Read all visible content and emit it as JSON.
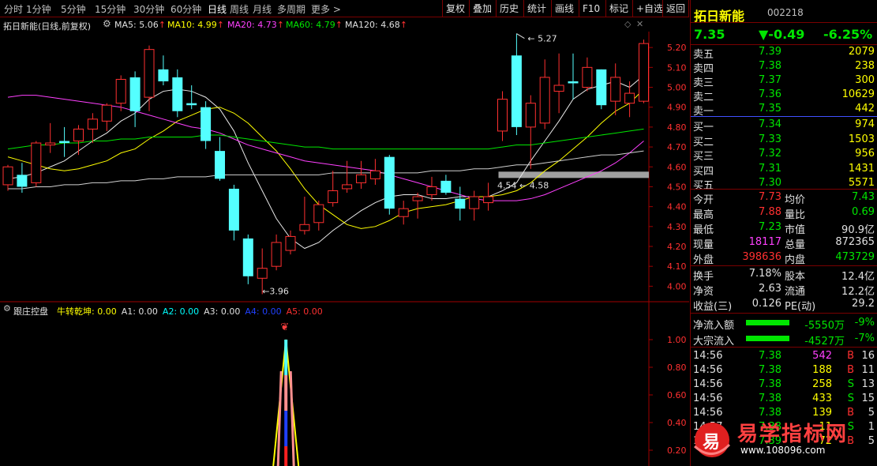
{
  "toolbar": {
    "periods": [
      "分时",
      "1分钟",
      "5分钟",
      "15分钟",
      "30分钟",
      "60分钟",
      "日线",
      "周线",
      "月线",
      "多周期",
      "更多 >"
    ],
    "active_index": 6,
    "right_buttons": [
      "复权",
      "叠加",
      "历史",
      "统计",
      "画线",
      "F10",
      "标记",
      "+自选",
      "返回"
    ]
  },
  "chart_header": {
    "title": "拓日新能(日线,前复权)",
    "ma5": "MA5: 5.06",
    "ma10": "MA10: 4.99",
    "ma20": "MA20: 4.73",
    "ma60": "MA60: 4.79",
    "ma120": "MA120: 4.68",
    "arrow": "↑"
  },
  "chart_data": {
    "type": "candlestick",
    "y_axis_ticks": [
      "5.20",
      "5.10",
      "5.00",
      "4.90",
      "4.80",
      "4.70",
      "4.60",
      "4.50",
      "4.40",
      "4.30",
      "4.20",
      "4.10",
      "4.00"
    ],
    "ylim": [
      3.93,
      5.28
    ],
    "annotations": {
      "high": "5.27",
      "low": "3.96",
      "mid_left": "4.54",
      "mid_right": "4.58"
    },
    "candles": [
      {
        "o": 4.51,
        "h": 4.61,
        "l": 4.48,
        "c": 4.6
      },
      {
        "o": 4.56,
        "h": 4.62,
        "l": 4.47,
        "c": 4.5
      },
      {
        "o": 4.52,
        "h": 4.73,
        "l": 4.5,
        "c": 4.72
      },
      {
        "o": 4.71,
        "h": 4.82,
        "l": 4.67,
        "c": 4.72
      },
      {
        "o": 4.73,
        "h": 4.8,
        "l": 4.65,
        "c": 4.72
      },
      {
        "o": 4.73,
        "h": 4.81,
        "l": 4.66,
        "c": 4.79
      },
      {
        "o": 4.79,
        "h": 4.87,
        "l": 4.72,
        "c": 4.84
      },
      {
        "o": 4.83,
        "h": 4.92,
        "l": 4.78,
        "c": 4.91
      },
      {
        "o": 4.92,
        "h": 5.06,
        "l": 4.88,
        "c": 5.04
      },
      {
        "o": 5.05,
        "h": 5.08,
        "l": 4.8,
        "c": 4.88
      },
      {
        "o": 4.95,
        "h": 5.21,
        "l": 4.88,
        "c": 5.19
      },
      {
        "o": 5.09,
        "h": 5.16,
        "l": 5.01,
        "c": 5.03
      },
      {
        "o": 5.05,
        "h": 5.09,
        "l": 4.85,
        "c": 4.88
      },
      {
        "o": 4.92,
        "h": 5.01,
        "l": 4.89,
        "c": 4.91
      },
      {
        "o": 4.9,
        "h": 4.93,
        "l": 4.69,
        "c": 4.73
      },
      {
        "o": 4.68,
        "h": 4.75,
        "l": 4.53,
        "c": 4.54
      },
      {
        "o": 4.49,
        "h": 4.51,
        "l": 4.23,
        "c": 4.28
      },
      {
        "o": 4.24,
        "h": 4.26,
        "l": 4.01,
        "c": 4.05
      },
      {
        "o": 4.04,
        "h": 4.19,
        "l": 3.96,
        "c": 4.09
      },
      {
        "o": 4.1,
        "h": 4.26,
        "l": 4.08,
        "c": 4.22
      },
      {
        "o": 4.18,
        "h": 4.28,
        "l": 4.16,
        "c": 4.25
      },
      {
        "o": 4.28,
        "h": 4.45,
        "l": 4.26,
        "c": 4.31
      },
      {
        "o": 4.32,
        "h": 4.43,
        "l": 4.28,
        "c": 4.41
      },
      {
        "o": 4.42,
        "h": 4.58,
        "l": 4.4,
        "c": 4.48
      },
      {
        "o": 4.49,
        "h": 4.63,
        "l": 4.47,
        "c": 4.51
      },
      {
        "o": 4.52,
        "h": 4.63,
        "l": 4.49,
        "c": 4.56
      },
      {
        "o": 4.54,
        "h": 4.64,
        "l": 4.51,
        "c": 4.58
      },
      {
        "o": 4.65,
        "h": 4.66,
        "l": 4.36,
        "c": 4.39
      },
      {
        "o": 4.35,
        "h": 4.43,
        "l": 4.31,
        "c": 4.39
      },
      {
        "o": 4.43,
        "h": 4.47,
        "l": 4.34,
        "c": 4.45
      },
      {
        "o": 4.46,
        "h": 4.55,
        "l": 4.43,
        "c": 4.5
      },
      {
        "o": 4.53,
        "h": 4.56,
        "l": 4.46,
        "c": 4.47
      },
      {
        "o": 4.44,
        "h": 4.5,
        "l": 4.33,
        "c": 4.39
      },
      {
        "o": 4.39,
        "h": 4.48,
        "l": 4.33,
        "c": 4.45
      },
      {
        "o": 4.42,
        "h": 4.52,
        "l": 4.38,
        "c": 4.45
      },
      {
        "o": 4.78,
        "h": 4.98,
        "l": 4.73,
        "c": 4.94
      },
      {
        "o": 5.16,
        "h": 5.27,
        "l": 4.76,
        "c": 4.8
      },
      {
        "o": 4.8,
        "h": 4.96,
        "l": 4.59,
        "c": 4.92
      },
      {
        "o": 4.82,
        "h": 5.14,
        "l": 4.79,
        "c": 5.05
      },
      {
        "o": 4.98,
        "h": 5.17,
        "l": 4.87,
        "c": 5.01
      },
      {
        "o": 5.03,
        "h": 5.17,
        "l": 4.94,
        "c": 5.02
      },
      {
        "o": 5.0,
        "h": 5.15,
        "l": 4.98,
        "c": 5.1
      },
      {
        "o": 5.09,
        "h": 5.09,
        "l": 4.89,
        "c": 4.91
      },
      {
        "o": 4.93,
        "h": 5.12,
        "l": 4.86,
        "c": 5.05
      },
      {
        "o": 4.92,
        "h": 5.03,
        "l": 4.85,
        "c": 4.97
      },
      {
        "o": 4.93,
        "h": 5.24,
        "l": 4.92,
        "c": 5.22
      }
    ],
    "ma_lines": [
      {
        "name": "MA5",
        "color": "#e8e8e8",
        "values": [
          4.54,
          4.55,
          4.57,
          4.6,
          4.63,
          4.68,
          4.73,
          4.77,
          4.83,
          4.87,
          4.94,
          4.98,
          4.99,
          4.98,
          4.95,
          4.89,
          4.78,
          4.62,
          4.48,
          4.34,
          4.24,
          4.19,
          4.22,
          4.28,
          4.33,
          4.38,
          4.42,
          4.45,
          4.46,
          4.46,
          4.44,
          4.44,
          4.45,
          4.45,
          4.45,
          4.48,
          4.52,
          4.63,
          4.73,
          4.83,
          4.94,
          4.99,
          5.01,
          5.03,
          5.0,
          5.06
        ]
      },
      {
        "name": "MA10",
        "color": "#ffff00",
        "values": [
          4.65,
          4.63,
          4.61,
          4.59,
          4.58,
          4.59,
          4.61,
          4.63,
          4.67,
          4.69,
          4.74,
          4.78,
          4.83,
          4.86,
          4.89,
          4.9,
          4.87,
          4.82,
          4.75,
          4.68,
          4.59,
          4.49,
          4.41,
          4.36,
          4.31,
          4.29,
          4.3,
          4.33,
          4.37,
          4.39,
          4.4,
          4.41,
          4.43,
          4.45,
          4.45,
          4.46,
          4.48,
          4.52,
          4.58,
          4.63,
          4.69,
          4.75,
          4.82,
          4.88,
          4.92,
          4.99
        ]
      },
      {
        "name": "MA20",
        "color": "#ff40ff",
        "values": [
          4.95,
          4.96,
          4.96,
          4.95,
          4.94,
          4.93,
          4.92,
          4.91,
          4.9,
          4.88,
          4.86,
          4.84,
          4.82,
          4.8,
          4.79,
          4.77,
          4.74,
          4.71,
          4.69,
          4.67,
          4.65,
          4.63,
          4.62,
          4.61,
          4.6,
          4.59,
          4.58,
          4.56,
          4.54,
          4.52,
          4.5,
          4.48,
          4.46,
          4.44,
          4.43,
          4.43,
          4.43,
          4.44,
          4.46,
          4.49,
          4.52,
          4.55,
          4.58,
          4.62,
          4.67,
          4.73
        ]
      },
      {
        "name": "MA60",
        "color": "#00e600",
        "values": [
          4.69,
          4.7,
          4.71,
          4.71,
          4.72,
          4.72,
          4.73,
          4.73,
          4.74,
          4.74,
          4.75,
          4.75,
          4.75,
          4.75,
          4.76,
          4.76,
          4.75,
          4.74,
          4.73,
          4.72,
          4.71,
          4.7,
          4.7,
          4.69,
          4.69,
          4.69,
          4.69,
          4.69,
          4.69,
          4.69,
          4.69,
          4.69,
          4.69,
          4.69,
          4.69,
          4.7,
          4.71,
          4.71,
          4.72,
          4.73,
          4.74,
          4.75,
          4.76,
          4.77,
          4.78,
          4.79
        ]
      },
      {
        "name": "MA120",
        "color": "#d0d0d0",
        "values": [
          4.49,
          4.49,
          4.5,
          4.5,
          4.51,
          4.51,
          4.52,
          4.52,
          4.53,
          4.53,
          4.54,
          4.54,
          4.55,
          4.55,
          4.55,
          4.56,
          4.56,
          4.56,
          4.56,
          4.56,
          4.56,
          4.56,
          4.56,
          4.57,
          4.57,
          4.57,
          4.57,
          4.57,
          4.57,
          4.57,
          4.58,
          4.58,
          4.58,
          4.59,
          4.59,
          4.6,
          4.61,
          4.61,
          4.62,
          4.63,
          4.64,
          4.65,
          4.66,
          4.66,
          4.67,
          4.68
        ]
      }
    ],
    "resistance_band": {
      "from_index": 35,
      "value": 4.56
    }
  },
  "indicator": {
    "name": "跟庄控盘",
    "items": [
      {
        "label": "牛转乾坤: 0.00",
        "color": "#ffff00"
      },
      {
        "label": "A1: 0.00",
        "color": "#e0e0e0"
      },
      {
        "label": "A2: 0.00",
        "color": "#00ffff"
      },
      {
        "label": "A3: 0.00",
        "color": "#e0e0e0"
      },
      {
        "label": "A4: 0.00",
        "color": "#2040ff"
      },
      {
        "label": "A5: 0.00",
        "color": "#ff3030"
      }
    ],
    "y_ticks": [
      "1.00",
      "0.80",
      "0.60",
      "0.40",
      "0.20"
    ],
    "spike_value": 1.0,
    "spike_index": 18
  },
  "stock": {
    "name": "拓日新能",
    "code": "002218",
    "price": "7.35",
    "change": "▼-0.49",
    "pct": "-6.25%"
  },
  "order_book": {
    "asks": [
      {
        "label": "卖五",
        "price": "7.39",
        "vol": "2079"
      },
      {
        "label": "卖四",
        "price": "7.38",
        "vol": "238"
      },
      {
        "label": "卖三",
        "price": "7.37",
        "vol": "300"
      },
      {
        "label": "卖二",
        "price": "7.36",
        "vol": "10629"
      },
      {
        "label": "卖一",
        "price": "7.35",
        "vol": "442"
      }
    ],
    "bids": [
      {
        "label": "买一",
        "price": "7.34",
        "vol": "974"
      },
      {
        "label": "买二",
        "price": "7.33",
        "vol": "1503"
      },
      {
        "label": "买三",
        "price": "7.32",
        "vol": "956"
      },
      {
        "label": "买四",
        "price": "7.31",
        "vol": "1431"
      },
      {
        "label": "买五",
        "price": "7.30",
        "vol": "5571"
      }
    ]
  },
  "stats": [
    {
      "l1": "今开",
      "v1": "7.73",
      "c1": "r",
      "l2": "均价",
      "v2": "7.43",
      "c2": "g"
    },
    {
      "l1": "最高",
      "v1": "7.88",
      "c1": "r",
      "l2": "量比",
      "v2": "0.69",
      "c2": "g"
    },
    {
      "l1": "最低",
      "v1": "7.23",
      "c1": "g",
      "l2": "市值",
      "v2": "90.9亿",
      "c2": "w"
    },
    {
      "l1": "现量",
      "v1": "18117",
      "c1": "m",
      "l2": "总量",
      "v2": "872365",
      "c2": "w"
    },
    {
      "l1": "外盘",
      "v1": "398636",
      "c1": "r",
      "l2": "内盘",
      "v2": "473729",
      "c2": "g"
    }
  ],
  "stats2": [
    {
      "l1": "换手",
      "v1": "7.18%",
      "l2": "股本",
      "v2": "12.4亿"
    },
    {
      "l1": "净资",
      "v1": "2.63",
      "l2": "流通",
      "v2": "12.2亿"
    },
    {
      "l1": "收益(三)",
      "v1": "0.126",
      "l2": "PE(动)",
      "v2": "29.2"
    }
  ],
  "flows": [
    {
      "label": "净流入额",
      "value": "-5550万",
      "pct": "-9%"
    },
    {
      "label": "大宗流入",
      "value": "-4527万",
      "pct": "-7%"
    }
  ],
  "trades": [
    {
      "time": "14:56",
      "price": "7.38",
      "vol": "542",
      "vcolor": "m",
      "bs": "B",
      "bcolor": "r",
      "n": "16"
    },
    {
      "time": "14:56",
      "price": "7.38",
      "vol": "188",
      "vcolor": "y",
      "bs": "B",
      "bcolor": "r",
      "n": "11"
    },
    {
      "time": "14:56",
      "price": "7.38",
      "vol": "258",
      "vcolor": "y",
      "bs": "S",
      "bcolor": "g",
      "n": "13"
    },
    {
      "time": "14:56",
      "price": "7.38",
      "vol": "433",
      "vcolor": "y",
      "bs": "S",
      "bcolor": "g",
      "n": "15"
    },
    {
      "time": "14:56",
      "price": "7.38",
      "vol": "139",
      "vcolor": "y",
      "bs": "B",
      "bcolor": "r",
      "n": "5"
    },
    {
      "time": "14:57",
      "price": "7.38",
      "vol": "11",
      "vcolor": "y",
      "bs": "S",
      "bcolor": "g",
      "n": "1"
    },
    {
      "time": "15:00",
      "price": "7.39",
      "vol": "72",
      "vcolor": "y",
      "bs": "B",
      "bcolor": "r",
      "n": "5"
    }
  ],
  "watermark": {
    "logo_char": "易",
    "title": "易学指标网",
    "url": "www.108096.com"
  }
}
